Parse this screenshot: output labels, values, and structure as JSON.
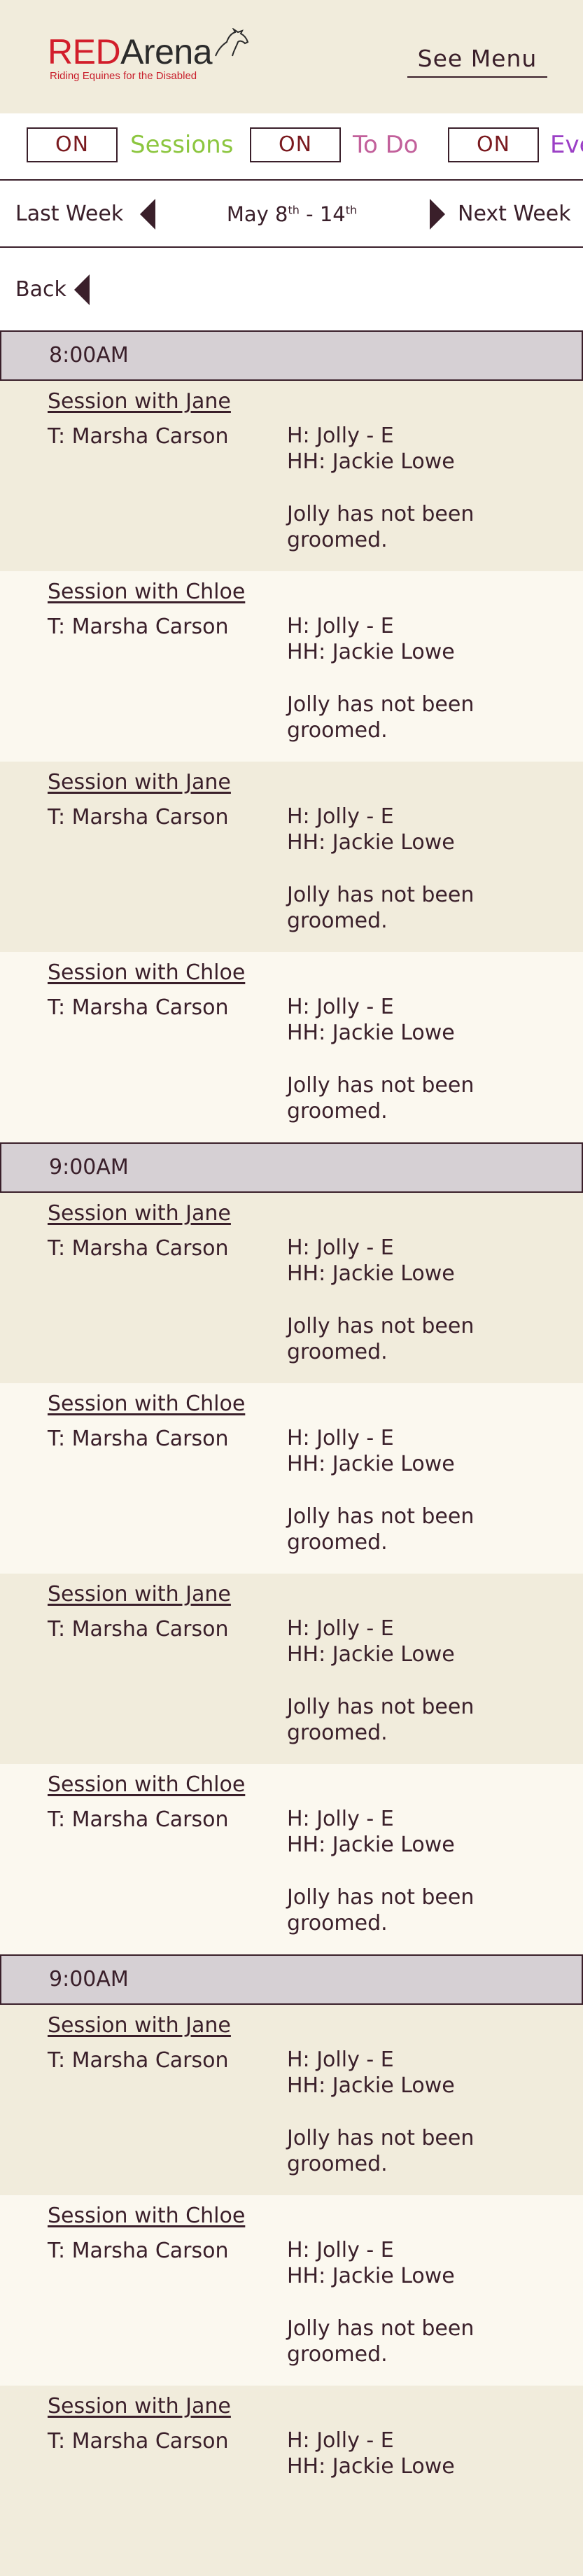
{
  "header": {
    "logo": {
      "brand_red": "RED",
      "brand_dark": "Arena",
      "tagline": "Riding Equines for the Disabled"
    },
    "menu_label": "See Menu"
  },
  "filters": [
    {
      "toggle": "ON",
      "label": "Sessions",
      "color": "#8cc63f"
    },
    {
      "toggle": "ON",
      "label": "To Do",
      "color": "#c2609b"
    },
    {
      "toggle": "ON",
      "label": "Events",
      "color": "#9b3fc6"
    }
  ],
  "week_nav": {
    "prev_label": "Last Week",
    "range_start": "May 8",
    "range_start_sup": "th",
    "range_sep": " - ",
    "range_end": "14",
    "range_end_sup": "th",
    "next_label": "Next Week"
  },
  "back_label": "Back",
  "groups": [
    {
      "time": "8:00AM",
      "sessions": [
        {
          "title": "Session with Jane",
          "trainer": "T: Marsha Carson",
          "horse": "H: Jolly - E",
          "handler": "HH: Jackie Lowe",
          "note": "Jolly has not been groomed."
        },
        {
          "title": "Session with Chloe",
          "trainer": "T: Marsha Carson",
          "horse": "H: Jolly - E",
          "handler": "HH: Jackie Lowe",
          "note": "Jolly has not been groomed."
        },
        {
          "title": "Session with Jane",
          "trainer": "T: Marsha Carson",
          "horse": "H: Jolly - E",
          "handler": "HH: Jackie Lowe",
          "note": "Jolly has not been groomed."
        },
        {
          "title": "Session with Chloe",
          "trainer": "T: Marsha Carson",
          "horse": "H: Jolly - E",
          "handler": "HH: Jackie Lowe",
          "note": "Jolly has not been groomed."
        }
      ]
    },
    {
      "time": "9:00AM",
      "sessions": [
        {
          "title": "Session with Jane",
          "trainer": "T: Marsha Carson",
          "horse": "H: Jolly - E",
          "handler": "HH: Jackie Lowe",
          "note": "Jolly has not been groomed."
        },
        {
          "title": "Session with Chloe",
          "trainer": "T: Marsha Carson",
          "horse": "H: Jolly - E",
          "handler": "HH: Jackie Lowe",
          "note": "Jolly has not been groomed."
        },
        {
          "title": "Session with Jane",
          "trainer": "T: Marsha Carson",
          "horse": "H: Jolly - E",
          "handler": "HH: Jackie Lowe",
          "note": "Jolly has not been groomed."
        },
        {
          "title": "Session with Chloe",
          "trainer": "T: Marsha Carson",
          "horse": "H: Jolly - E",
          "handler": "HH: Jackie Lowe",
          "note": "Jolly has not been groomed."
        }
      ]
    },
    {
      "time": "9:00AM",
      "sessions": [
        {
          "title": "Session with Jane",
          "trainer": "T: Marsha Carson",
          "horse": "H: Jolly - E",
          "handler": "HH: Jackie Lowe",
          "note": "Jolly has not been groomed."
        },
        {
          "title": "Session with Chloe",
          "trainer": "T: Marsha Carson",
          "horse": "H: Jolly - E",
          "handler": "HH: Jackie Lowe",
          "note": "Jolly has not been groomed."
        },
        {
          "title": "Session with Jane",
          "trainer": "T: Marsha Carson",
          "horse": "H: Jolly - E",
          "handler": "HH: Jackie Lowe",
          "note": ""
        }
      ]
    }
  ]
}
